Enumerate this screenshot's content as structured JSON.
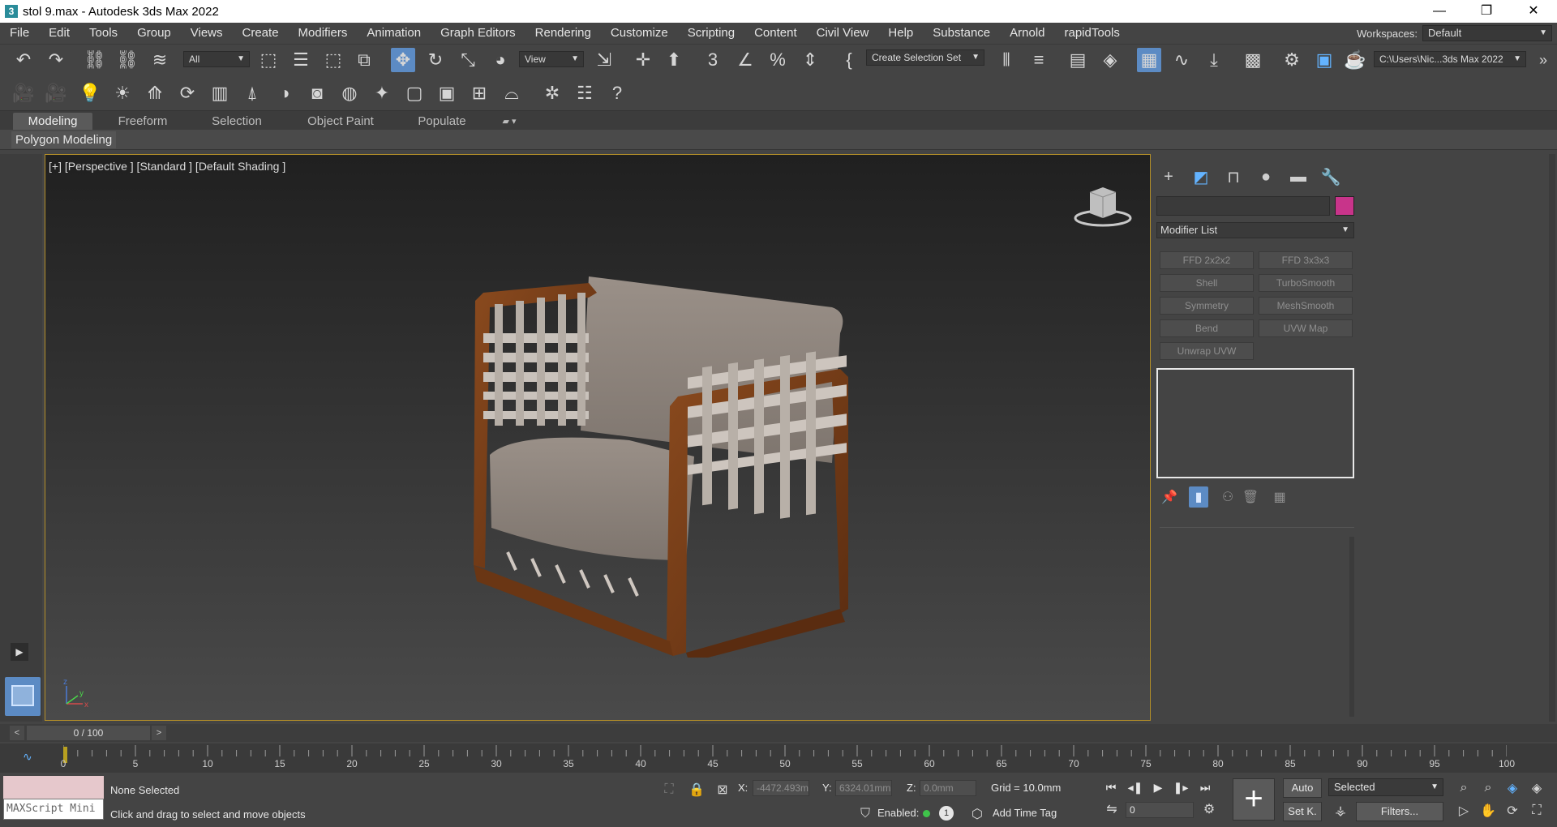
{
  "window": {
    "title": "stol 9.max - Autodesk 3ds Max 2022",
    "minimize": "—",
    "restore": "❐",
    "close": "✕"
  },
  "menu": [
    "File",
    "Edit",
    "Tools",
    "Group",
    "Views",
    "Create",
    "Modifiers",
    "Animation",
    "Graph Editors",
    "Rendering",
    "Customize",
    "Scripting",
    "Content",
    "Civil View",
    "Help",
    "Substance",
    "Arnold",
    "rapidTools"
  ],
  "workspaces": {
    "label": "Workspaces:",
    "value": "Default"
  },
  "toolbar": {
    "selection_filter": "All",
    "reference_coord": "View",
    "selection_set": "Create Selection Set",
    "project_path": "C:\\Users\\Nic...3ds Max 2022"
  },
  "ribbon": {
    "tabs": [
      "Modeling",
      "Freeform",
      "Selection",
      "Object Paint",
      "Populate"
    ],
    "active_tab": "Modeling",
    "subpanel": "Polygon Modeling"
  },
  "viewport": {
    "label": "[+] [Perspective ] [Standard ] [Default Shading ]",
    "axis_z": "z",
    "axis_x": "x",
    "axis_y": "y"
  },
  "command_panel": {
    "object_color": "#c8348a",
    "modifier_list": "Modifier List",
    "modifier_buttons": [
      "FFD 2x2x2",
      "FFD 3x3x3",
      "Shell",
      "TurboSmooth",
      "Symmetry",
      "MeshSmooth",
      "Bend",
      "UVW Map",
      "Unwrap UVW"
    ]
  },
  "time_slider": {
    "prev": "<",
    "frame": "0 / 100",
    "next": ">"
  },
  "track_bar": {
    "start": 0,
    "end": 100,
    "labels": [
      "0",
      "5",
      "10",
      "15",
      "20",
      "25",
      "30",
      "35",
      "40",
      "45",
      "50",
      "55",
      "60",
      "65",
      "70",
      "75",
      "80",
      "85",
      "90",
      "95",
      "100"
    ]
  },
  "status": {
    "maxscript": "MAXScript Mini",
    "selection": "None Selected",
    "prompt": "Click and drag to select and move objects",
    "x_label": "X:",
    "x_value": "-4472.493m",
    "y_label": "Y:",
    "y_value": "6324.01mm",
    "z_label": "Z:",
    "z_value": "0.0mm",
    "grid": "Grid = 10.0mm",
    "enabled_label": "Enabled:",
    "enabled_count": "1",
    "add_time_tag": "Add Time Tag",
    "auto": "Auto",
    "set_key": "Set K.",
    "key_filter": "Selected",
    "filters": "Filters...",
    "current_frame": "0"
  },
  "colors": {
    "accent": "#5c8bc4",
    "viewport_border": "#b48f28",
    "active_icon": "#63b3ff"
  }
}
